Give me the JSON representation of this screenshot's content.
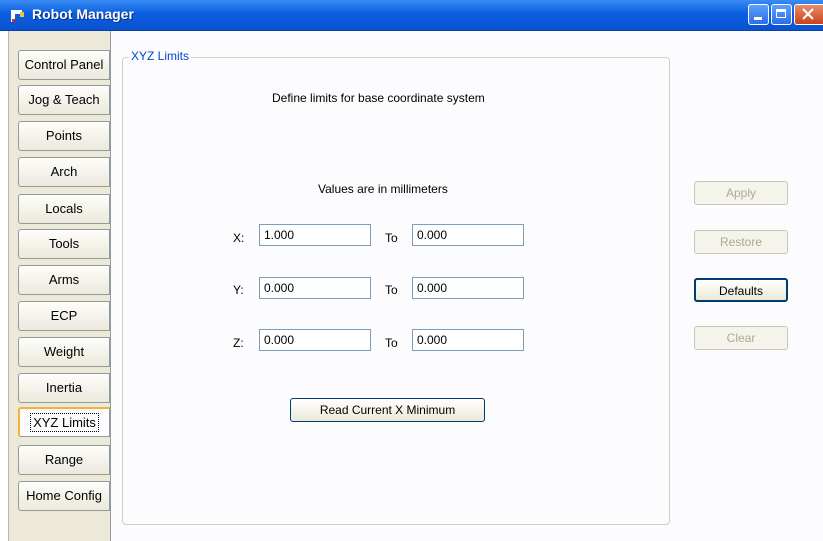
{
  "window": {
    "title": "Robot Manager"
  },
  "tabs": [
    {
      "label": "Control Panel",
      "active": false
    },
    {
      "label": "Jog & Teach",
      "active": false
    },
    {
      "label": "Points",
      "active": false
    },
    {
      "label": "Arch",
      "active": false
    },
    {
      "label": "Locals",
      "active": false
    },
    {
      "label": "Tools",
      "active": false
    },
    {
      "label": "Arms",
      "active": false
    },
    {
      "label": "ECP",
      "active": false
    },
    {
      "label": "Weight",
      "active": false
    },
    {
      "label": "Inertia",
      "active": false
    },
    {
      "label": "XYZ Limits",
      "active": true
    },
    {
      "label": "Range",
      "active": false
    },
    {
      "label": "Home Config",
      "active": false
    }
  ],
  "group": {
    "label": "XYZ Limits",
    "heading": "Define limits for base coordinate system",
    "units_note": "Values are in millimeters",
    "to_label": "To",
    "rows": [
      {
        "axis": "X:",
        "min": "1.000",
        "max": "0.000"
      },
      {
        "axis": "Y:",
        "min": "0.000",
        "max": "0.000"
      },
      {
        "axis": "Z:",
        "min": "0.000",
        "max": "0.000"
      }
    ],
    "read_button": "Read Current X Minimum"
  },
  "actions": {
    "apply": "Apply",
    "restore": "Restore",
    "defaults": "Defaults",
    "clear": "Clear"
  }
}
